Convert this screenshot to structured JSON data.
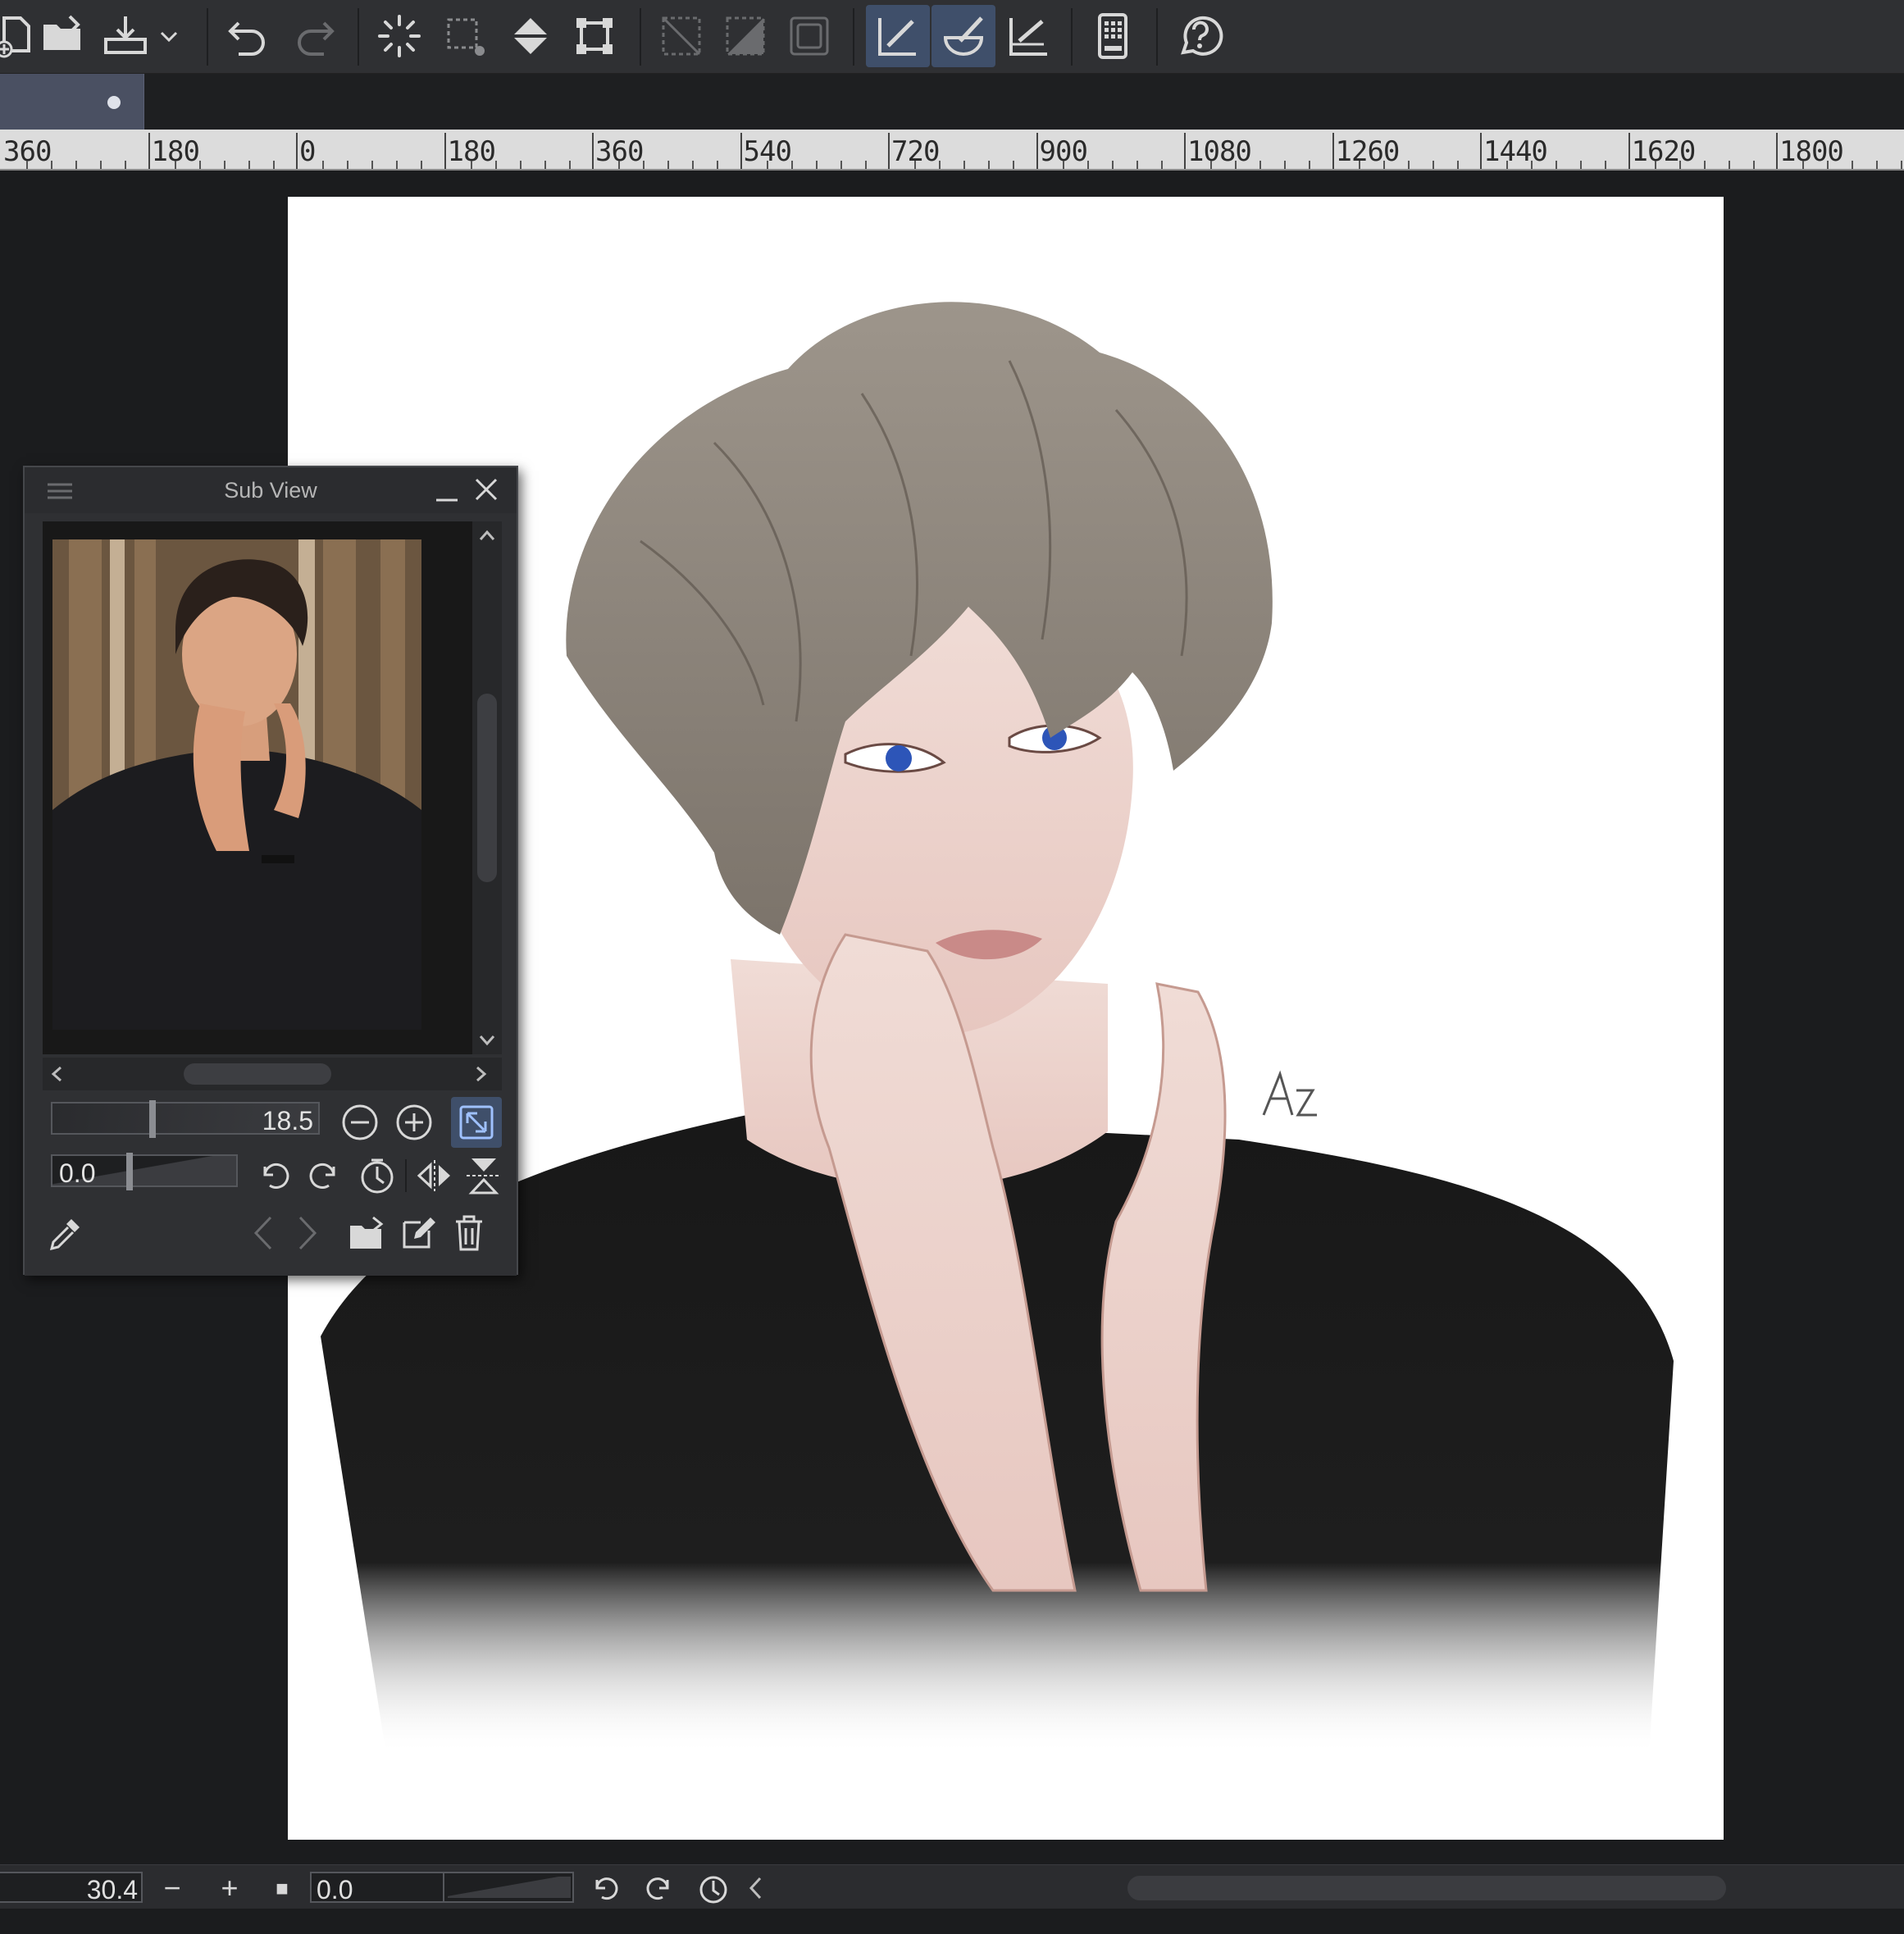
{
  "app": {
    "toolbar": {
      "buttons": [
        "new-file",
        "open-file",
        "save-file",
        "save-dropdown",
        "undo",
        "redo",
        "select-loading",
        "marquee",
        "fill",
        "transform",
        "selection-clear",
        "selection-invert",
        "selection-border",
        "pen-pressure",
        "brush-stabilizer",
        "ruler-snap",
        "device-settings",
        "help"
      ]
    },
    "canvas_tab": {
      "modified_marker": "•"
    },
    "ruler": {
      "labels": [
        "360",
        "180",
        "0",
        "180",
        "360",
        "540",
        "720",
        "900",
        "1080",
        "1260",
        "1440",
        "1620",
        "1800"
      ]
    },
    "sub_view": {
      "title": "Sub View",
      "zoom_value": "18.5",
      "rotation_value": "0.0"
    },
    "status_bar": {
      "zoom_value": "30.4",
      "rotation_value": "0.0",
      "zoom_out_label": "−",
      "zoom_in_label": "+",
      "fit_label": "■"
    },
    "colors": {
      "toolbar_bg": "#2f3033",
      "accent_active": "#3f4f6a",
      "workspace_bg": "#1b1c1e",
      "paper": "#ffffff"
    }
  }
}
